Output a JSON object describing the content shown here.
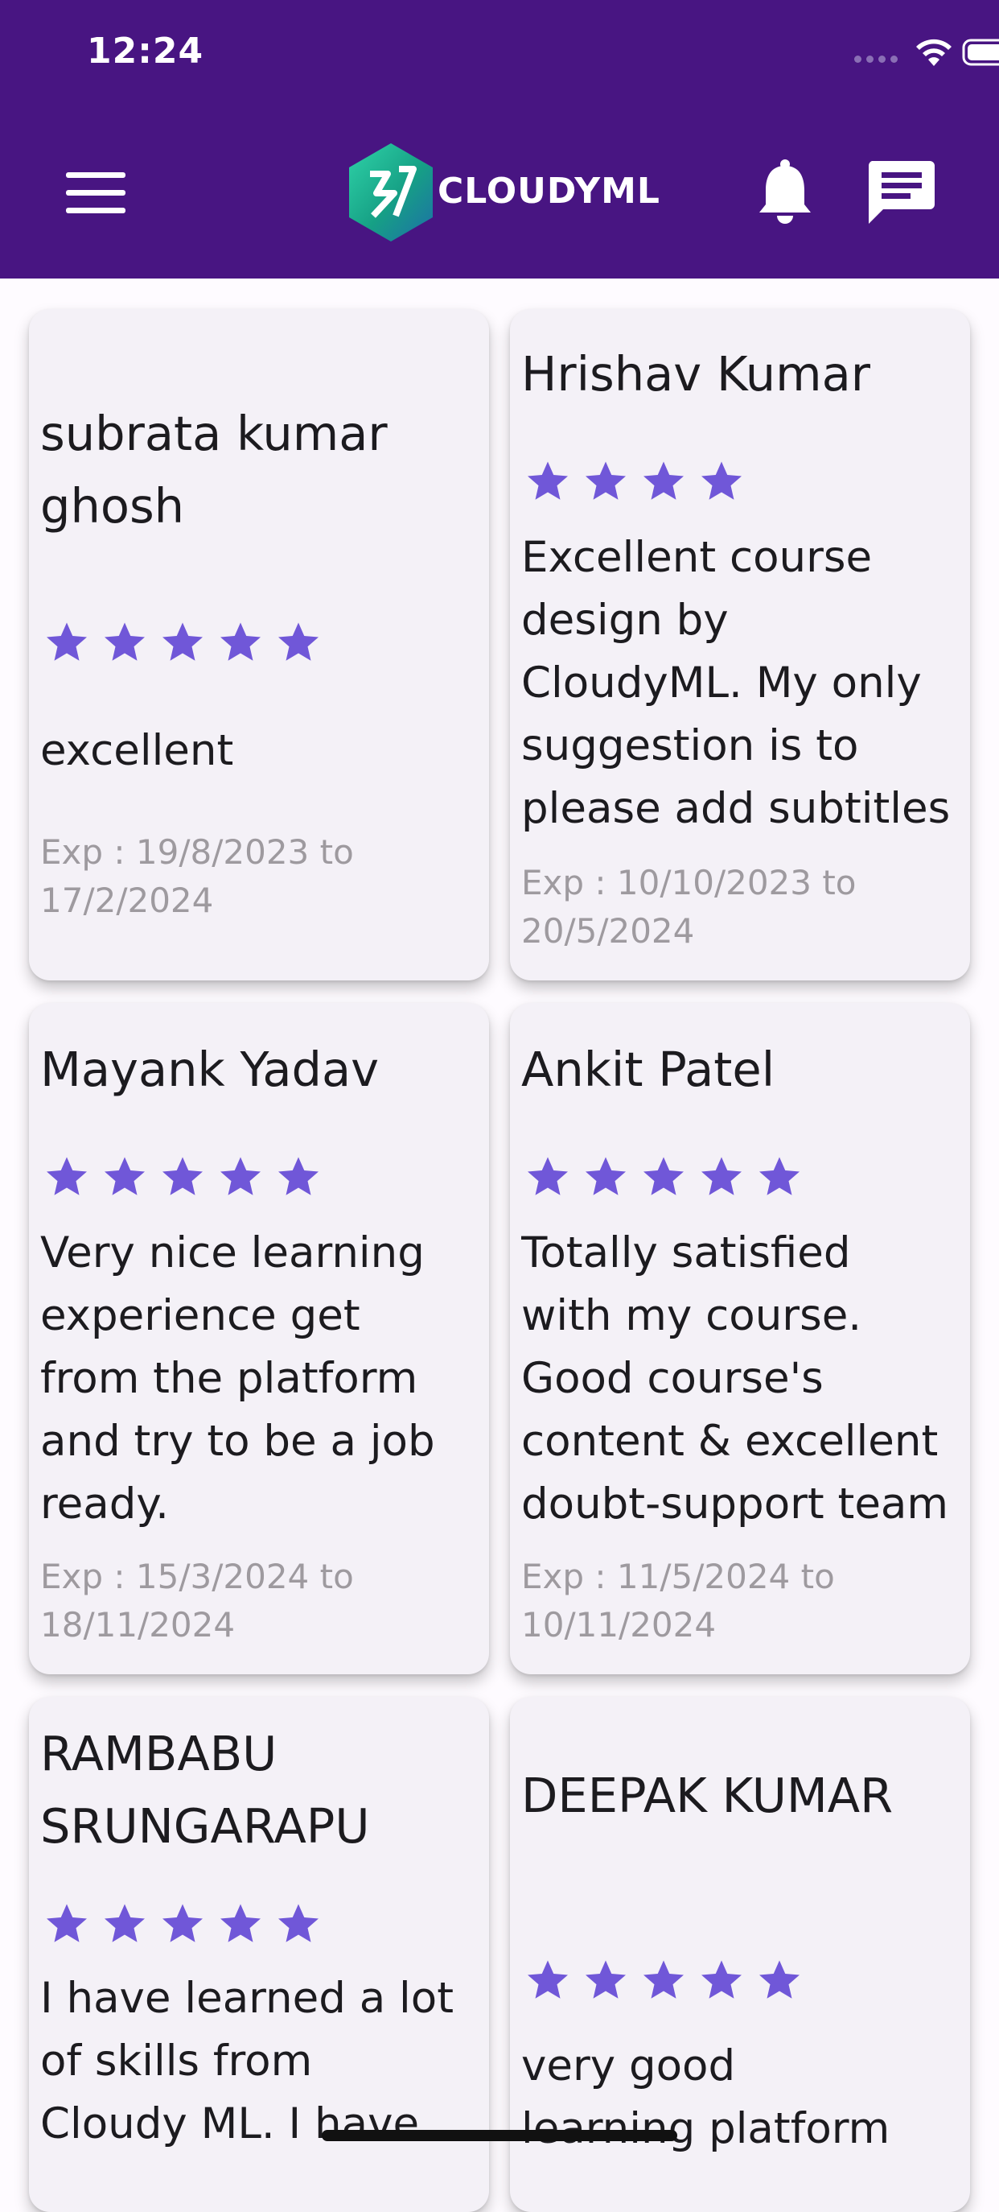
{
  "status_bar": {
    "time": "12:24"
  },
  "header": {
    "brand": "CLOUDYML"
  },
  "colors": {
    "appbar": "#481582",
    "star": "#7057d8",
    "card": "#f4f1f7"
  },
  "reviews": [
    {
      "name": [
        "subrata kumar",
        "ghosh"
      ],
      "rating": 5,
      "text": [
        "excellent"
      ],
      "exp": [
        "Exp : 19/8/2023 to",
        "17/2/2024"
      ]
    },
    {
      "name": [
        "Hrishav Kumar"
      ],
      "rating": 4,
      "text": [
        "Excellent course",
        "design by",
        "CloudyML.  My only",
        "suggestion is to",
        "please add subtitles"
      ],
      "exp": [
        "Exp : 10/10/2023 to",
        "20/5/2024"
      ]
    },
    {
      "name": [
        "Mayank Yadav"
      ],
      "rating": 5,
      "text": [
        "Very nice learning",
        "experience get",
        "from the platform",
        "and try to be a job",
        "ready."
      ],
      "exp": [
        "Exp : 15/3/2024 to",
        "18/11/2024"
      ]
    },
    {
      "name": [
        "Ankit Patel"
      ],
      "rating": 5,
      "text": [
        "Totally satisfied",
        "with my course.",
        "Good course's",
        "content & excellent",
        "doubt-support team"
      ],
      "exp": [
        "Exp : 11/5/2024 to",
        "10/11/2024"
      ]
    },
    {
      "name": [
        "RAMBABU",
        "SRUNGARAPU"
      ],
      "rating": 5,
      "text": [
        "I have learned a lot",
        "of skills from",
        "Cloudy ML. I have"
      ],
      "exp": []
    },
    {
      "name": [
        "DEEPAK KUMAR"
      ],
      "rating": 5,
      "text": [
        "very good",
        "learning platform"
      ],
      "exp": []
    }
  ]
}
